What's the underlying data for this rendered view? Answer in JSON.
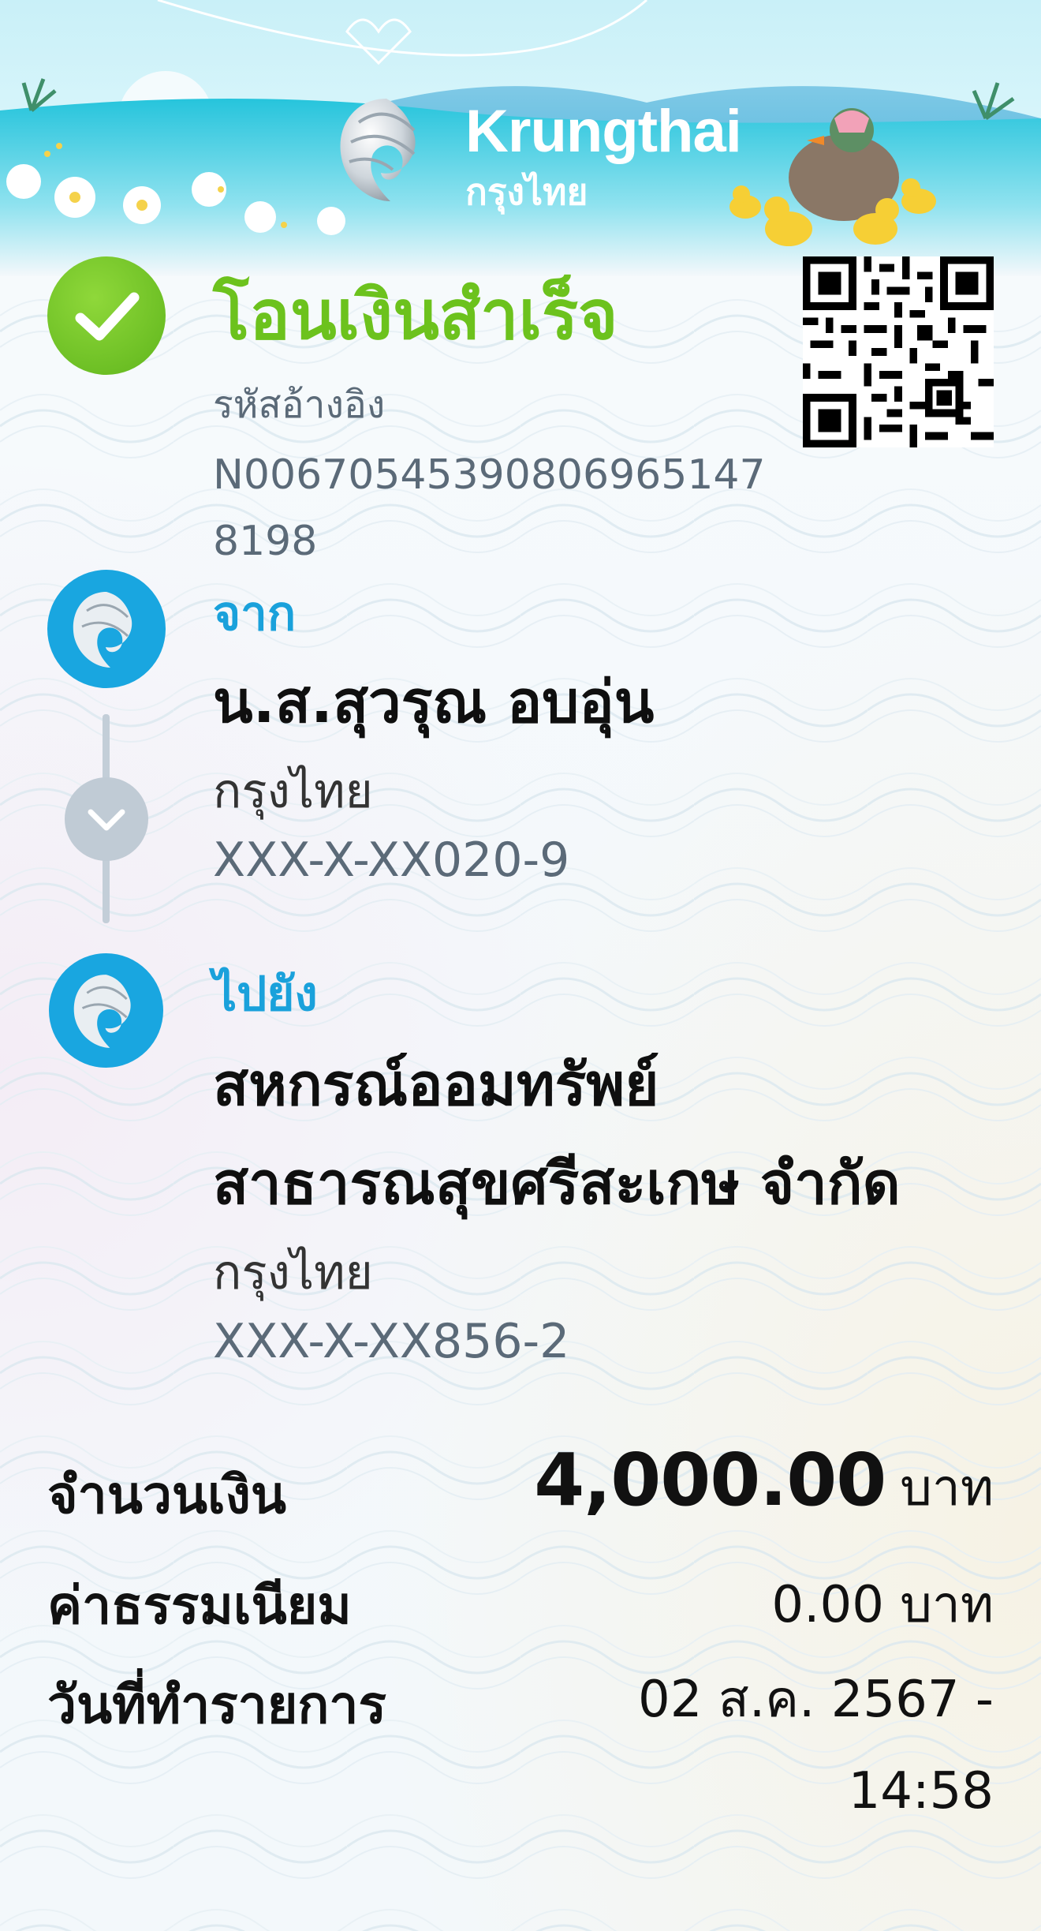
{
  "header": {
    "brand_en": "Krungthai",
    "brand_th": "กรุงไทย"
  },
  "status": {
    "title": "โอนเงินสำเร็จ",
    "ref_label": "รหัสอ้างอิง",
    "ref_value": "N006705453908069651478198"
  },
  "from": {
    "label": "จาก",
    "name": "น.ส.สุวรุณ อบอุ่น",
    "bank": "กรุงไทย",
    "account": "XXX-X-XX020-9"
  },
  "to": {
    "label": "ไปยัง",
    "name_line1": "สหกรณ์ออมทรัพย์",
    "name_line2": "สาธารณสุขศรีสะเกษ จำกัด",
    "bank": "กรุงไทย",
    "account": "XXX-X-XX856-2"
  },
  "summary": {
    "amount_label": "จำนวนเงิน",
    "amount_value": "4,000.00",
    "amount_unit": "บาท",
    "fee_label": "ค่าธรรมเนียม",
    "fee_value": "0.00 บาท",
    "date_label": "วันที่ทำรายการ",
    "date_line1": "02 ส.ค. 2567 -",
    "date_line2": "14:58"
  },
  "icons": {
    "success": "check-circle-icon",
    "bank": "krungthai-bird-icon",
    "timeline": "chevron-down-icon",
    "qr": "qr-code"
  },
  "colors": {
    "success_green": "#6cc21d",
    "accent_blue": "#1aa1db",
    "bank_blue": "#19a6e0",
    "muted_text": "#5b6a78"
  }
}
